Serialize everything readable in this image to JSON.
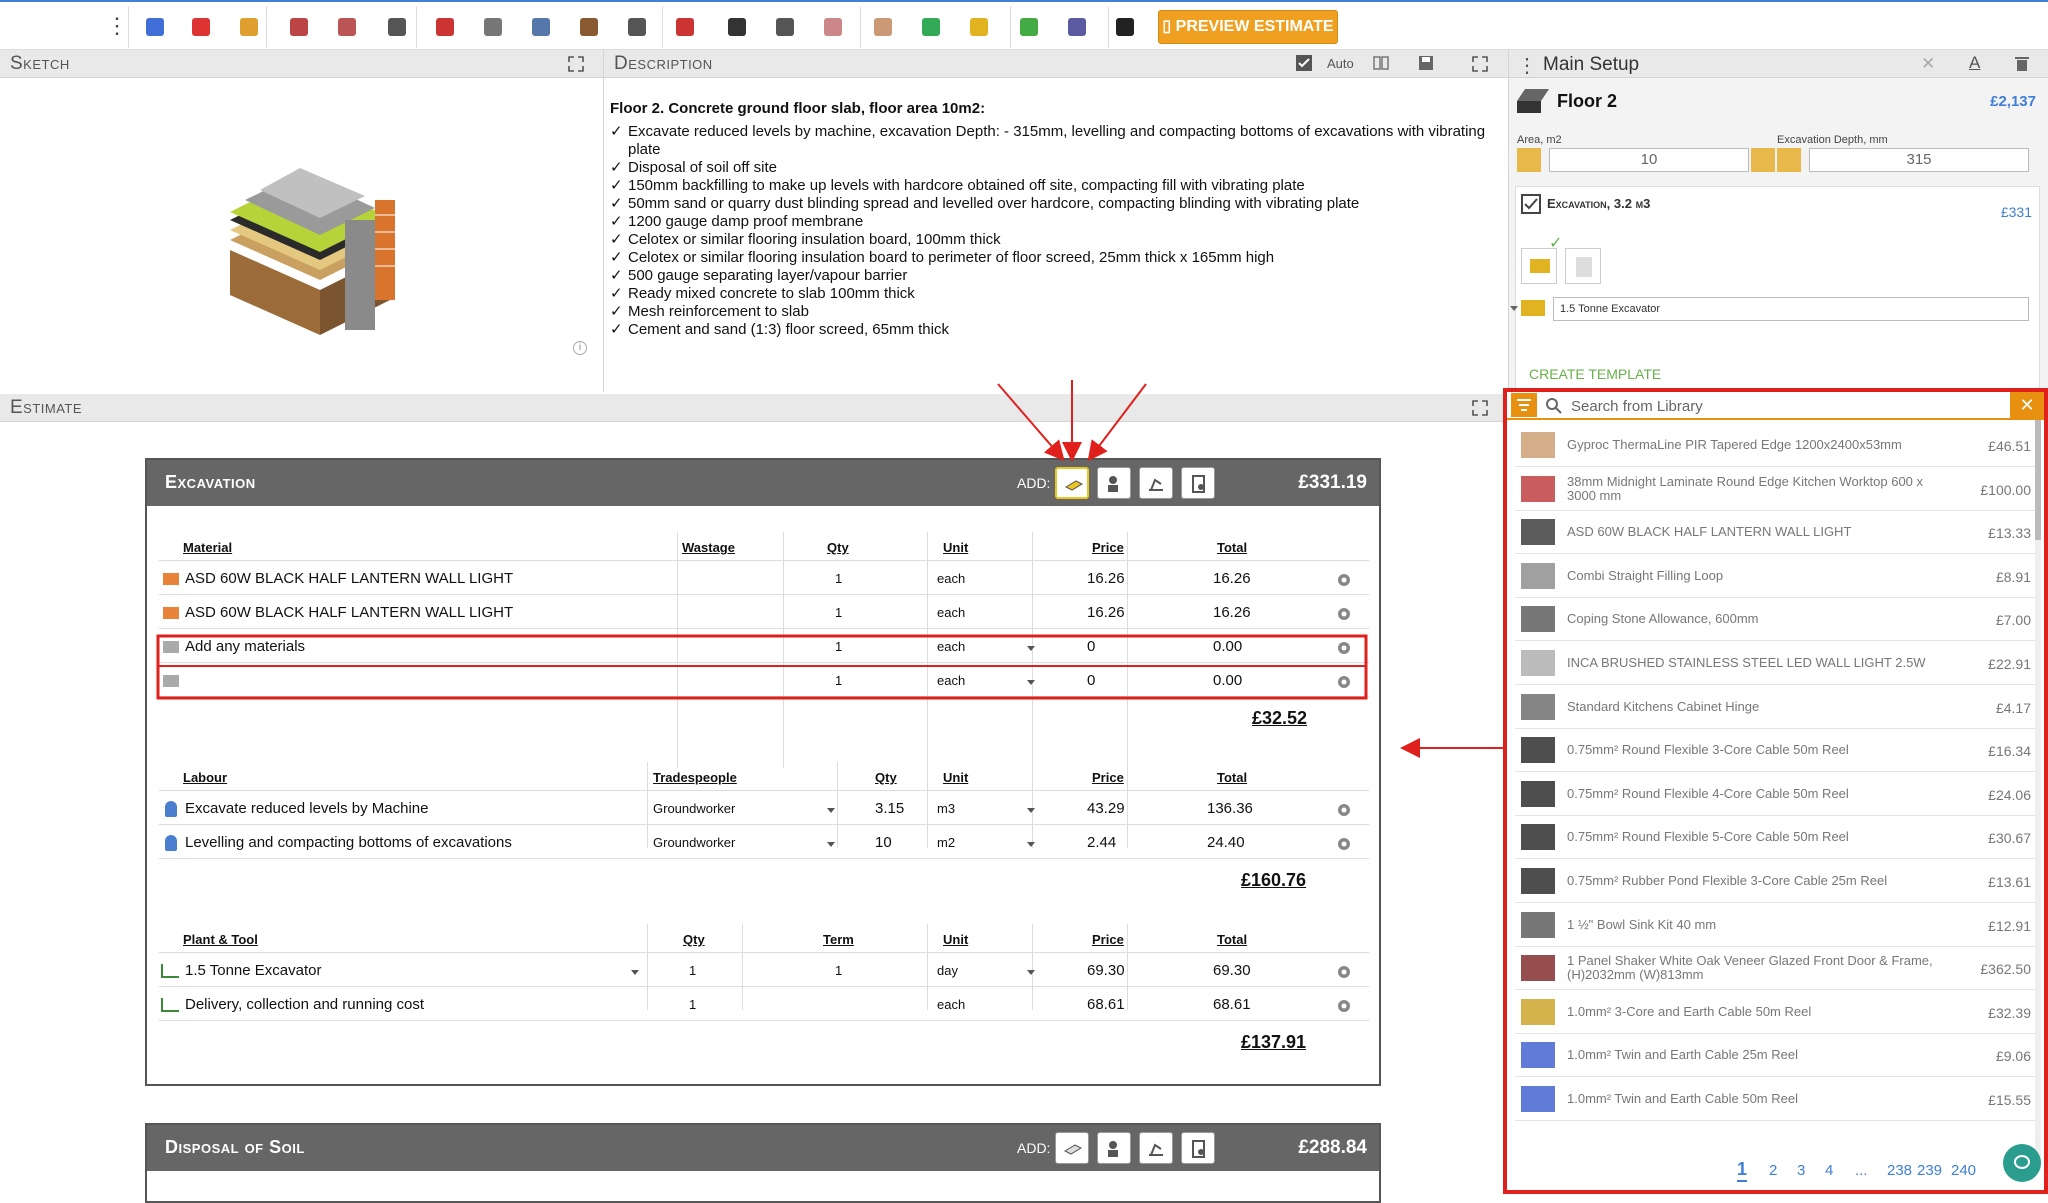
{
  "toolbar": {
    "icons": [
      "user-card-icon",
      "hazard-icon",
      "roll-icon",
      "roof-tile-icon",
      "brick-wall-icon",
      "slab-icon",
      "bricks-icon",
      "trowel-icon",
      "window-icon",
      "beam-icon",
      "tools-icon",
      "roof-icon",
      "smoke-detector-icon",
      "tap-icon",
      "radiator-icon",
      "plaster-icon",
      "panel-icon",
      "plan-icon",
      "tree-icon",
      "money-icon",
      "person-icon"
    ],
    "preview_label": "PREVIEW ESTIMATE"
  },
  "sketch": {
    "title": "Sketch"
  },
  "description": {
    "title": "Description",
    "auto_label": "Auto",
    "heading": "Floor 2.    Concrete ground floor slab, floor area 10m2:",
    "lines": [
      "Excavate reduced levels by machine, excavation Depth: - 315mm, levelling and compacting bottoms of excavations with vibrating plate",
      "Disposal of soil off site",
      "150mm backfilling to make up levels with hardcore obtained off site, compacting fill with vibrating plate",
      "50mm sand or quarry dust blinding spread and levelled over hardcore, compacting blinding with vibrating plate",
      "1200 gauge damp proof membrane",
      "Celotex or similar flooring insulation board, 100mm thick",
      "Celotex or similar flooring insulation board to perimeter of floor screed, 25mm thick x 165mm high",
      "500 gauge separating layer/vapour barrier",
      "Ready mixed concrete to slab 100mm thick",
      "Mesh reinforcement to slab",
      "Cement and sand (1:3) floor screed, 65mm thick"
    ]
  },
  "setup": {
    "title": "Main Setup",
    "floor_name": "Floor 2",
    "floor_total": "£2,137",
    "area_label": "Area, m2",
    "area_value": "10",
    "depth_label": "Excavation Depth, mm",
    "depth_value": "315",
    "excavation_label": "Excavation, 3.2 m3",
    "excavation_total": "£331",
    "machine_select": "1.5 Tonne Excavator",
    "create_template": "CREATE TEMPLATE"
  },
  "estimate": {
    "title": "Estimate",
    "add_label": "ADD:",
    "excavation": {
      "title": "Excavation",
      "total": "£331.19",
      "materials_headers": [
        "Material",
        "Wastage",
        "Qty",
        "Unit",
        "Price",
        "Total"
      ],
      "materials": [
        {
          "name": "ASD 60W BLACK HALF LANTERN WALL LIGHT",
          "qty": "1",
          "unit": "each",
          "price": "16.26",
          "total": "16.26"
        },
        {
          "name": "ASD 60W BLACK HALF LANTERN WALL LIGHT",
          "qty": "1",
          "unit": "each",
          "price": "16.26",
          "total": "16.26"
        },
        {
          "name": "Add any materials",
          "qty": "1",
          "unit": "each",
          "price": "0",
          "total": "0.00"
        },
        {
          "name": "",
          "qty": "1",
          "unit": "each",
          "price": "0",
          "total": "0.00"
        }
      ],
      "materials_subtotal": "£32.52",
      "labour_headers": [
        "Labour",
        "Tradespeople",
        "Qty",
        "Unit",
        "Price",
        "Total"
      ],
      "labour": [
        {
          "name": "Excavate reduced levels by Machine",
          "trade": "Groundworker",
          "qty": "3.15",
          "unit": "m3",
          "price": "43.29",
          "total": "136.36"
        },
        {
          "name": "Levelling and compacting bottoms of excavations",
          "trade": "Groundworker",
          "qty": "10",
          "unit": "m2",
          "price": "2.44",
          "total": "24.40"
        }
      ],
      "labour_subtotal": "£160.76",
      "plant_headers": [
        "Plant & Tool",
        "Qty",
        "Term",
        "Unit",
        "Price",
        "Total"
      ],
      "plant": [
        {
          "name": "1.5 Tonne Excavator",
          "qty": "1",
          "term": "1",
          "unit": "day",
          "price": "69.30",
          "total": "69.30"
        },
        {
          "name": "Delivery, collection and running cost",
          "qty": "1",
          "term": "",
          "unit": "each",
          "price": "68.61",
          "total": "68.61"
        }
      ],
      "plant_subtotal": "£137.91"
    },
    "disposal": {
      "title": "Disposal of Soil",
      "total": "£288.84"
    }
  },
  "library": {
    "search_placeholder": "Search from Library",
    "items": [
      {
        "name": "Gyproc ThermaLine PIR Tapered Edge 1200x2400x53mm",
        "price": "£46.51"
      },
      {
        "name": "38mm Midnight Laminate Round Edge Kitchen Worktop 600 x 3000 mm",
        "price": "£100.00"
      },
      {
        "name": "ASD 60W BLACK HALF LANTERN WALL LIGHT",
        "price": "£13.33"
      },
      {
        "name": "Combi Straight Filling Loop",
        "price": "£8.91"
      },
      {
        "name": "Coping Stone Allowance, 600mm",
        "price": "£7.00"
      },
      {
        "name": "INCA BRUSHED STAINLESS STEEL LED WALL LIGHT 2.5W",
        "price": "£22.91"
      },
      {
        "name": "Standard Kitchens Cabinet Hinge",
        "price": "£4.17"
      },
      {
        "name": "0.75mm² Round Flexible 3-Core Cable 50m Reel",
        "price": "£16.34"
      },
      {
        "name": "0.75mm² Round Flexible 4-Core Cable 50m Reel",
        "price": "£24.06"
      },
      {
        "name": "0.75mm² Round Flexible 5-Core Cable 50m Reel",
        "price": "£30.67"
      },
      {
        "name": "0.75mm² Rubber Pond Flexible 3-Core Cable 25m Reel",
        "price": "£13.61"
      },
      {
        "name": "1 ½\" Bowl Sink Kit 40 mm",
        "price": "£12.91"
      },
      {
        "name": "1 Panel Shaker White Oak Veneer Glazed Front Door & Frame, (H)2032mm (W)813mm",
        "price": "£362.50"
      },
      {
        "name": "1.0mm² 3-Core and Earth Cable 50m Reel",
        "price": "£32.39"
      },
      {
        "name": "1.0mm² Twin and Earth Cable 25m Reel",
        "price": "£9.06"
      },
      {
        "name": "1.0mm² Twin and Earth Cable 50m Reel",
        "price": "£15.55"
      }
    ],
    "pages": [
      "1",
      "2",
      "3",
      "4",
      "...",
      "238",
      "239",
      "240"
    ]
  }
}
